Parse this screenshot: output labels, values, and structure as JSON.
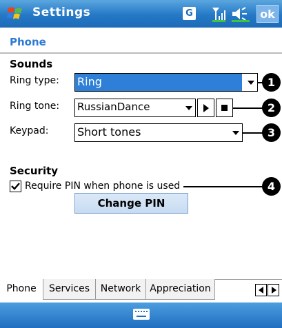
{
  "titlebar": {
    "title": "Settings",
    "network_badge": "G",
    "ok_label": "ok"
  },
  "page": {
    "heading": "Phone"
  },
  "sounds": {
    "section_label": "Sounds",
    "ring_type": {
      "label": "Ring type:",
      "value": "Ring"
    },
    "ring_tone": {
      "label": "Ring tone:",
      "value": "RussianDance"
    },
    "keypad": {
      "label": "Keypad:",
      "value": "Short tones"
    }
  },
  "security": {
    "section_label": "Security",
    "require_pin": {
      "label": "Require PIN when phone is used",
      "checked": true
    },
    "change_pin_label": "Change PIN"
  },
  "callouts": [
    "1",
    "2",
    "3",
    "4"
  ],
  "tabs": [
    "Phone",
    "Services",
    "Network",
    "Appreciation"
  ],
  "active_tab": "Phone",
  "icons": {
    "start": "windows-flag-icon",
    "signal": "signal-strength-icon",
    "volume": "speaker-icon",
    "keyboard": "keyboard-icon",
    "play": "play-icon",
    "stop": "stop-icon"
  },
  "colors": {
    "titlebar": "#2478c5",
    "heading": "#2b79d0",
    "selection": "#2d7fd8"
  }
}
